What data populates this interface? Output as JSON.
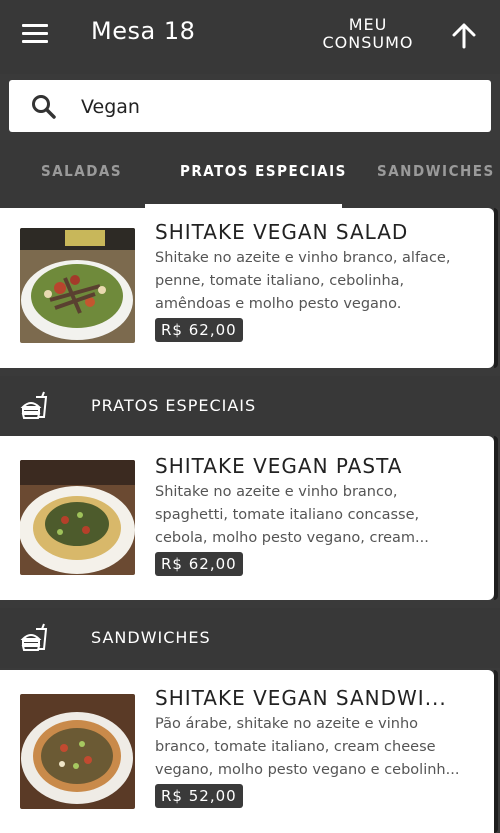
{
  "header": {
    "table_title": "Mesa 18",
    "consumo_label": "MEU\nCONSUMO"
  },
  "search": {
    "value": "Vegan"
  },
  "tabs": [
    {
      "label": "SALADAS",
      "active": false
    },
    {
      "label": "PRATOS ESPECIAIS",
      "active": true
    },
    {
      "label": "SANDWICHES",
      "active": false
    }
  ],
  "items": [
    {
      "name": "SHITAKE VEGAN SALAD",
      "description": "Shitake no azeite e vinho branco, alface, penne, tomate italiano, cebolinha, amêndoas e molho pesto vegano.",
      "price": "R$ 62,00"
    },
    {
      "name": "SHITAKE VEGAN PASTA",
      "description": "Shitake no azeite e vinho branco, spaghetti, tomate italiano concasse, cebola, molho pesto vegano, cream...",
      "price": "R$ 62,00"
    },
    {
      "name": "SHITAKE VEGAN SANDWI...",
      "description": "Pão árabe, shitake no azeite e vinho branco, tomate italiano, cream cheese vegano, molho pesto vegano e cebolinh...",
      "price": "R$ 52,00"
    }
  ],
  "sections": [
    {
      "title": "PRATOS ESPECIAIS",
      "icon": "burger-drink-icon"
    },
    {
      "title": "SANDWICHES",
      "icon": "burger-drink-icon"
    }
  ],
  "colors": {
    "bar": "#383838",
    "card": "#ffffff",
    "price_badge": "#3a3a3a"
  }
}
